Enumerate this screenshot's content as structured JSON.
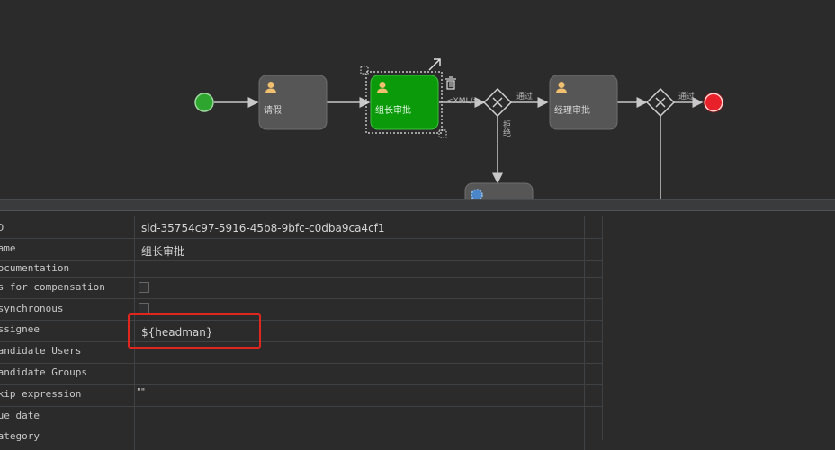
{
  "diagram": {
    "tasks": [
      {
        "id": "task-apply",
        "label": "请假",
        "icon": "user-icon"
      },
      {
        "id": "task-leader",
        "label": "组长审批",
        "icon": "user-icon",
        "selected": true
      },
      {
        "id": "task-manager",
        "label": "经理审批",
        "icon": "user-icon"
      }
    ],
    "edge_labels": {
      "pass1": "通过",
      "pass2": "通过",
      "reject": "拒绝",
      "xml": "<XML/>"
    },
    "selection_tools": [
      "resize-handle-icon",
      "trash-icon"
    ],
    "colors": {
      "start": "#2ea52e",
      "end": "#e8202a",
      "selected_task": "#0a9a0a",
      "task": "#565656"
    }
  },
  "properties": {
    "rows": [
      {
        "name": "ID",
        "value": "sid-35754c97-5916-45b8-9bfc-c0dba9ca4cf1",
        "type": "text"
      },
      {
        "name": "Name",
        "value": "组长审批",
        "type": "text"
      },
      {
        "name": "Documentation",
        "value": "",
        "type": "text"
      },
      {
        "name": "Is for compensation",
        "value": "",
        "type": "checkbox"
      },
      {
        "name": "Asynchronous",
        "value": "",
        "type": "checkbox"
      },
      {
        "name": "Assignee",
        "value": "${headman}",
        "type": "text"
      },
      {
        "name": "Candidate Users",
        "value": "",
        "type": "text"
      },
      {
        "name": "Candidate Groups",
        "value": "",
        "type": "text"
      },
      {
        "name": "Skip expression",
        "value": "\"\"",
        "type": "text"
      },
      {
        "name": "Due date",
        "value": "",
        "type": "text"
      },
      {
        "name": "Category",
        "value": "",
        "type": "text"
      }
    ]
  }
}
